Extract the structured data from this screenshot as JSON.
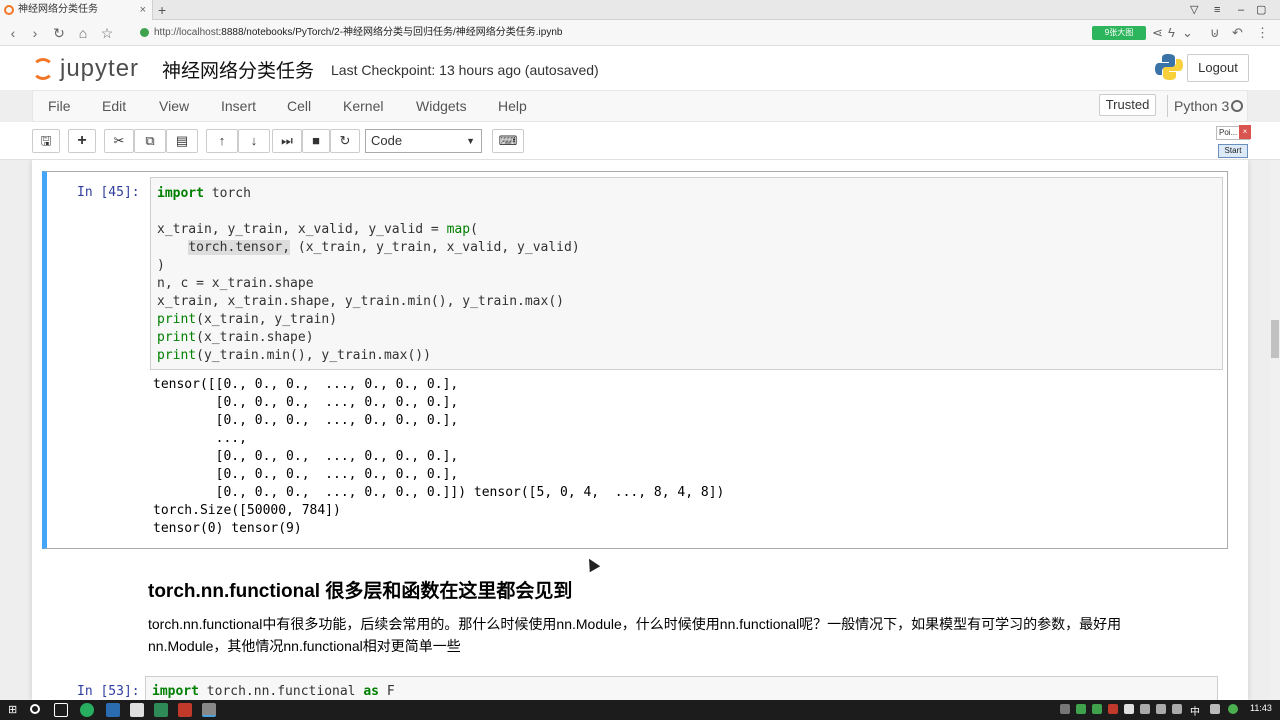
{
  "browser": {
    "tab_title": "神经网络分类任务",
    "tab_close": "×",
    "new_tab": "+",
    "url_host": "http://localhost",
    "url_rest": ":8888/notebooks/PyTorch/2-神经网络分类与回归任务/神经网络分类任务.ipynb",
    "ext_badge": "9张大图"
  },
  "header": {
    "logo_text": "jupyter",
    "notebook_title": "神经网络分类任务",
    "checkpoint": "Last Checkpoint: 13 hours ago (autosaved)",
    "logout_label": "Logout"
  },
  "menubar": {
    "items": [
      "File",
      "Edit",
      "View",
      "Insert",
      "Cell",
      "Kernel",
      "Widgets",
      "Help"
    ],
    "trusted": "Trusted",
    "kernel": "Python 3"
  },
  "toolbar": {
    "cell_type": "Code"
  },
  "popup": {
    "title": "Poi...",
    "close": "×",
    "start": "Start"
  },
  "cell1": {
    "prompt": "In [45]:",
    "code": [
      "import torch",
      "",
      "x_train, y_train, x_valid, y_valid = map(",
      "    torch.tensor, (x_train, y_train, x_valid, y_valid)",
      ")",
      "n, c = x_train.shape",
      "x_train, x_train.shape, y_train.min(), y_train.max()",
      "print(x_train, y_train)",
      "print(x_train.shape)",
      "print(y_train.min(), y_train.max())"
    ],
    "output": [
      "tensor([[0., 0., 0.,  ..., 0., 0., 0.],",
      "        [0., 0., 0.,  ..., 0., 0., 0.],",
      "        [0., 0., 0.,  ..., 0., 0., 0.],",
      "        ...,",
      "        [0., 0., 0.,  ..., 0., 0., 0.],",
      "        [0., 0., 0.,  ..., 0., 0., 0.],",
      "        [0., 0., 0.,  ..., 0., 0., 0.]]) tensor([5, 0, 4,  ..., 8, 4, 8])",
      "torch.Size([50000, 784])",
      "tensor(0) tensor(9)"
    ]
  },
  "markdown": {
    "heading": "torch.nn.functional 很多层和函数在这里都会见到",
    "para_line1": "torch.nn.functional中有很多功能，后续会常用的。那什么时候使用nn.Module，什么时候使用nn.functional呢？一般情况下，如果模型有可学习的参数，最好用",
    "para_line2": "nn.Module，其他情况nn.functional相对更简单一些"
  },
  "cell2": {
    "prompt": "In [53]:",
    "code": "import torch.nn.functional as F"
  },
  "taskbar": {
    "ime": "中",
    "clock": "11:43"
  },
  "colors": {
    "accent_selected": "#42a5f5",
    "jupyter_orange": "#f37626",
    "prompt_blue": "#303f9f"
  }
}
